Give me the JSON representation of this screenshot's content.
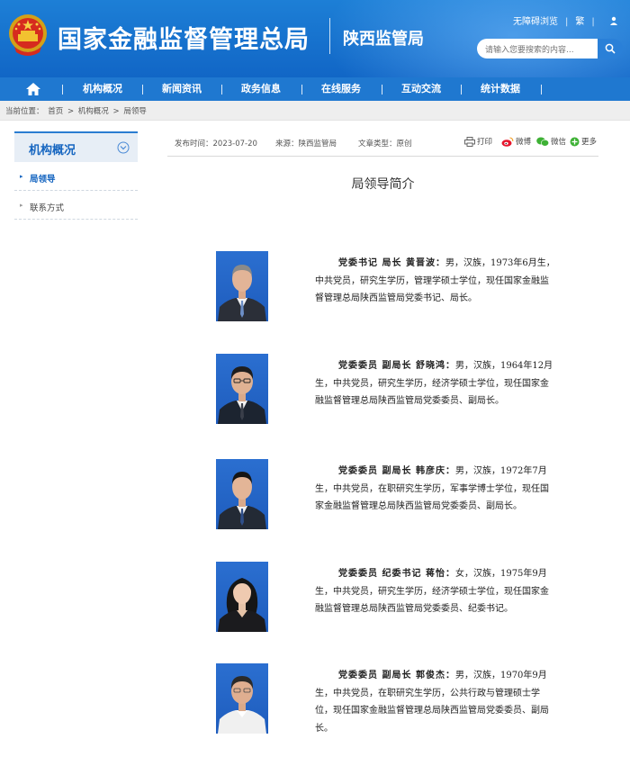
{
  "header": {
    "site_name": "国家金融监督管理总局",
    "sub_name": "陕西监管局",
    "accessibility": "无障碍浏览",
    "traditional": "繁",
    "search_placeholder": "请输入您要搜索的内容..."
  },
  "nav": {
    "items": [
      "机构概况",
      "新闻资讯",
      "政务信息",
      "在线服务",
      "互动交流",
      "统计数据"
    ]
  },
  "breadcrumb": {
    "label": "当前位置：",
    "path": [
      "首页",
      ">",
      "机构概况",
      ">",
      "局领导"
    ]
  },
  "sidebar": {
    "title": "机构概况",
    "items": [
      {
        "label": "局领导",
        "active": true
      },
      {
        "label": "联系方式",
        "active": false
      }
    ]
  },
  "meta": {
    "publish_time": "发布时间：2023-07-20",
    "source": "来源：陕西监管局",
    "doc_type": "文章类型：原创",
    "print": "打印",
    "weibo": "微博",
    "wechat": "微信",
    "more": "更多"
  },
  "page_title": "局领导简介",
  "leaders": [
    {
      "title": "党委书记 局长 黄晋波：",
      "bio": "男，汉族，1973年6月生，中共党员，研究生学历，管理学硕士学位，现任国家金融监督管理总局陕西监管局党委书记、局长。"
    },
    {
      "title": "党委委员 副局长 舒晓鸿：",
      "bio": "男，汉族，1964年12月生，中共党员，研究生学历，经济学硕士学位，现任国家金融监督管理总局陕西监管局党委委员、副局长。"
    },
    {
      "title": "党委委员 副局长 韩彦庆：",
      "bio": "男，汉族，1972年7月生，中共党员，在职研究生学历，军事学博士学位，现任国家金融监督管理总局陕西监管局党委委员、副局长。"
    },
    {
      "title": "党委委员 纪委书记 蒋怡：",
      "bio": "女，汉族，1975年9月生，中共党员，研究生学历，经济学硕士学位，现任国家金融监督管理总局陕西监管局党委委员、纪委书记。"
    },
    {
      "title": "党委委员 副局长 郭俊杰：",
      "bio": "男，汉族，1970年9月生，中共党员，在职研究生学历，公共行政与管理硕士学位，现任国家金融监督管理总局陕西监管局党委委员、副局长。"
    }
  ],
  "colors": {
    "header_blue": "#1166c6",
    "nav_blue": "#1f78d0",
    "accent_blue": "#1565c0"
  }
}
